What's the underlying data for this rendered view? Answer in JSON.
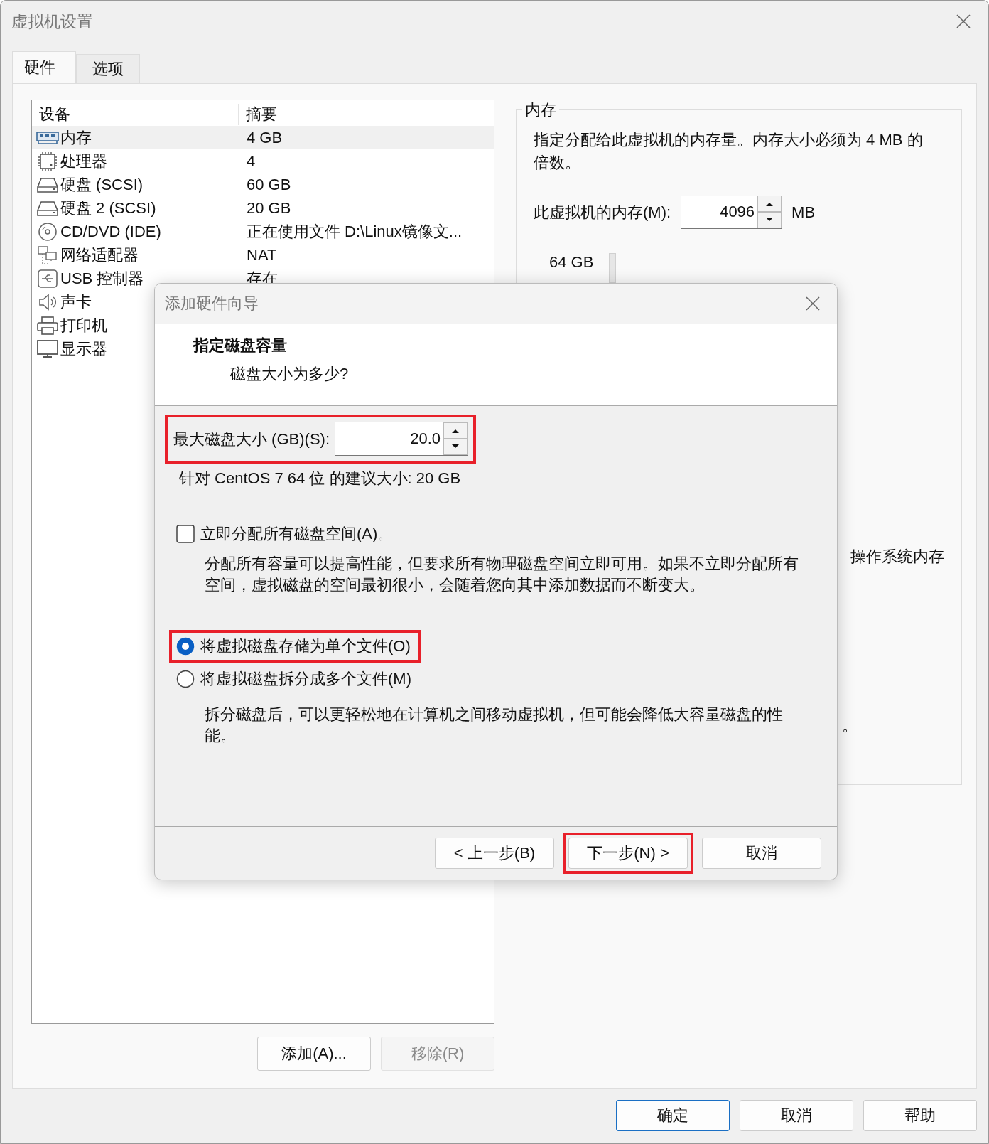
{
  "window": {
    "title": "虚拟机设置"
  },
  "tabs": [
    {
      "label": "硬件",
      "selected": true
    },
    {
      "label": "选项",
      "selected": false
    }
  ],
  "devices": {
    "columns": [
      "设备",
      "摘要"
    ],
    "rows": [
      {
        "kind": "memory",
        "name": "内存",
        "summary": "4 GB",
        "selected": true
      },
      {
        "kind": "cpu",
        "name": "处理器",
        "summary": "4",
        "selected": false
      },
      {
        "kind": "disk",
        "name": "硬盘 (SCSI)",
        "summary": "60 GB",
        "selected": false
      },
      {
        "kind": "disk",
        "name": "硬盘 2 (SCSI)",
        "summary": "20 GB",
        "selected": false
      },
      {
        "kind": "cdrom",
        "name": "CD/DVD (IDE)",
        "summary": "正在使用文件 D:\\Linux镜像文...",
        "selected": false
      },
      {
        "kind": "network",
        "name": "网络适配器",
        "summary": "NAT",
        "selected": false
      },
      {
        "kind": "usb",
        "name": "USB 控制器",
        "summary": "存在",
        "selected": false
      },
      {
        "kind": "sound",
        "name": "声卡",
        "selected": false
      },
      {
        "kind": "printer",
        "name": "打印机",
        "selected": false
      },
      {
        "kind": "display",
        "name": "显示器",
        "selected": false
      }
    ]
  },
  "device_buttons": [
    {
      "label": "添加(A)...",
      "disabled": false
    },
    {
      "label": "移除(R)",
      "disabled": true
    }
  ],
  "memory_panel": {
    "title": "内存",
    "description": "指定分配给此虚拟机的内存量。内存大小必须为 4 MB 的倍数。",
    "field_label": "此虚拟机的内存(M):",
    "value": "4096",
    "unit": "MB",
    "scale_label": "64 GB",
    "partial_text": "操作系统内存",
    "partial_mark": "。"
  },
  "dialog": {
    "title": "添加硬件向导",
    "heading": "指定磁盘容量",
    "subheading": "磁盘大小为多少?",
    "size_label": "最大磁盘大小 (GB)(S):",
    "size_value": "20.0",
    "size_highlighted": true,
    "recommendation": "针对 CentOS 7 64 位 的建议大小: 20 GB",
    "allocate": {
      "label": "立即分配所有磁盘空间(A)。",
      "checked": false,
      "description": "分配所有容量可以提高性能，但要求所有物理磁盘空间立即可用。如果不立即分配所有空间，虚拟磁盘的空间最初很小，会随着您向其中添加数据而不断变大。"
    },
    "storage_options": [
      {
        "label": "将虚拟磁盘存储为单个文件(O)",
        "selected": true,
        "highlighted": true
      },
      {
        "label": "将虚拟磁盘拆分成多个文件(M)",
        "selected": false,
        "highlighted": false,
        "description": "拆分磁盘后，可以更轻松地在计算机之间移动虚拟机，但可能会降低大容量磁盘的性能。"
      }
    ],
    "buttons": [
      {
        "label": "< 上一步(B)",
        "highlighted": false
      },
      {
        "label": "下一步(N) >",
        "highlighted": true
      },
      {
        "label": "取消",
        "highlighted": false
      }
    ]
  },
  "footer_buttons": [
    {
      "label": "确定",
      "default": true
    },
    {
      "label": "取消",
      "default": false
    },
    {
      "label": "帮助",
      "default": false
    }
  ]
}
